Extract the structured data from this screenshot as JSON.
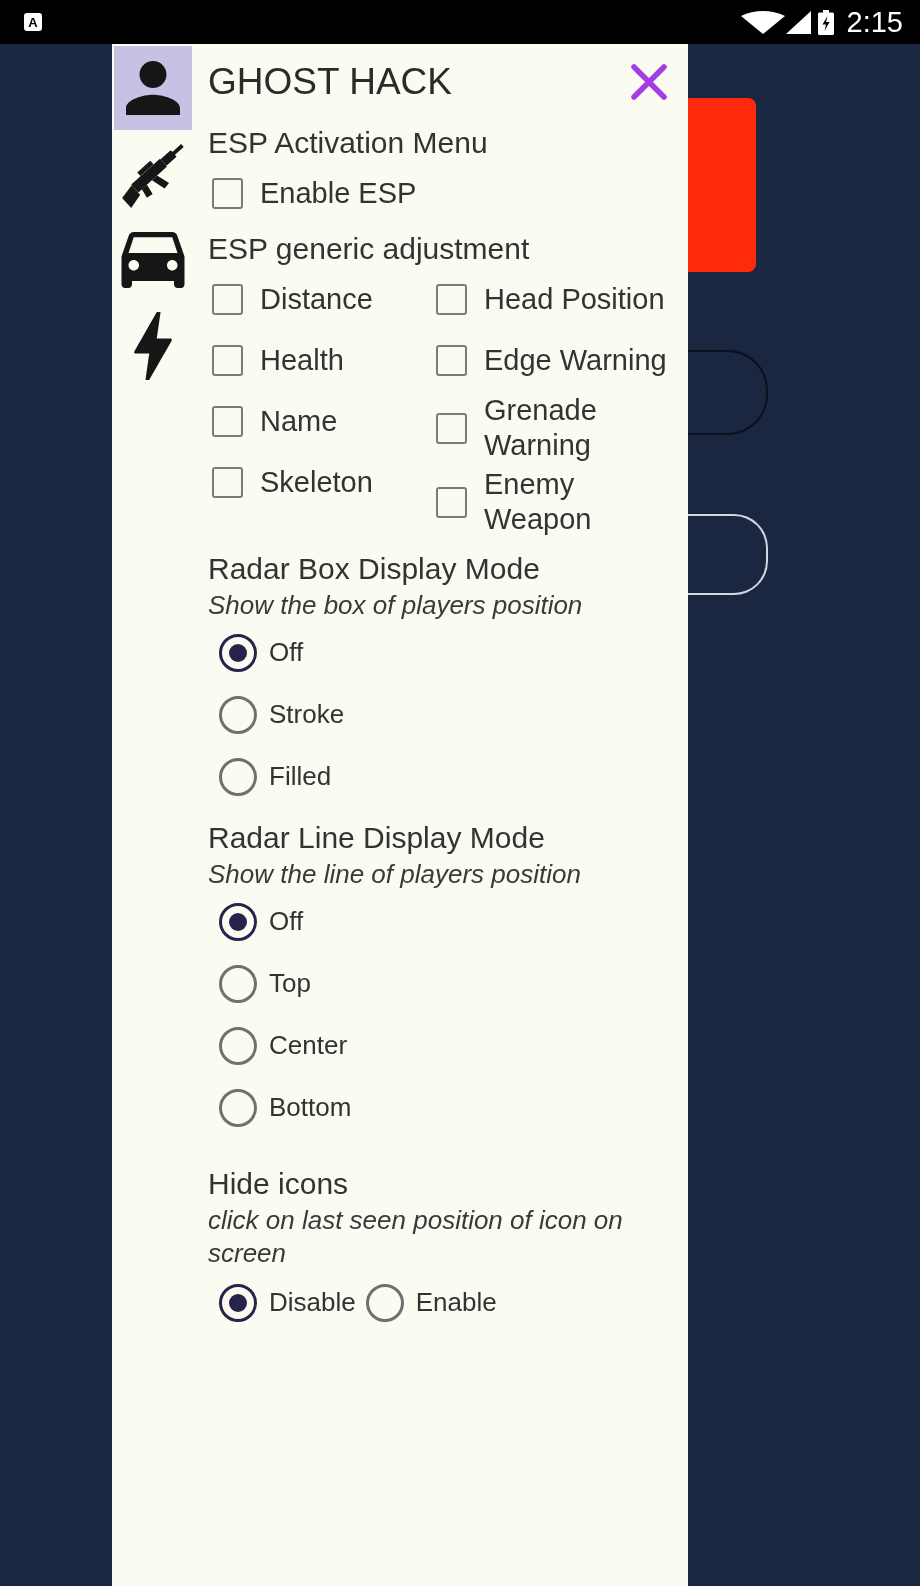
{
  "status_bar": {
    "notification_badge": "A",
    "time": "2:15"
  },
  "sidebar": {
    "tabs": [
      {
        "selected": true
      },
      {
        "selected": false
      },
      {
        "selected": false
      },
      {
        "selected": false
      }
    ]
  },
  "menu": {
    "title": "GHOST HACK",
    "activation": {
      "heading": "ESP Activation Menu",
      "options": [
        {
          "label": "Enable ESP",
          "checked": false
        }
      ]
    },
    "adjustment": {
      "heading": "ESP generic adjustment",
      "columns": [
        {
          "options": [
            {
              "label": "Distance",
              "checked": false
            },
            {
              "label": "Health",
              "checked": false
            },
            {
              "label": "Name",
              "checked": false
            },
            {
              "label": "Skeleton",
              "checked": false
            }
          ]
        },
        {
          "options": [
            {
              "label": "Head Position",
              "checked": false
            },
            {
              "label": "Edge Warning",
              "checked": false
            },
            {
              "label": "Grenade Warning",
              "checked": false
            },
            {
              "label": "Enemy Weapon",
              "checked": false
            }
          ]
        }
      ]
    },
    "sections": [
      {
        "kind": "radio_list",
        "heading": "Radar Box Display Mode",
        "subtitle": "Show the box of players position",
        "options": [
          {
            "label": "Off",
            "selected": true
          },
          {
            "label": "Stroke",
            "selected": false
          },
          {
            "label": "Filled",
            "selected": false
          }
        ]
      },
      {
        "kind": "radio_list",
        "heading": "Radar Line Display Mode",
        "subtitle": "Show the line of players position",
        "options": [
          {
            "label": "Off",
            "selected": true
          },
          {
            "label": "Top",
            "selected": false
          },
          {
            "label": "Center",
            "selected": false
          },
          {
            "label": "Bottom",
            "selected": false
          }
        ]
      },
      {
        "kind": "radio_inline",
        "heading": "Hide icons",
        "subtitle": "click on last seen position of icon on screen",
        "options": [
          {
            "label": "Disable",
            "selected": true
          },
          {
            "label": "Enable",
            "selected": false
          }
        ]
      }
    ]
  }
}
